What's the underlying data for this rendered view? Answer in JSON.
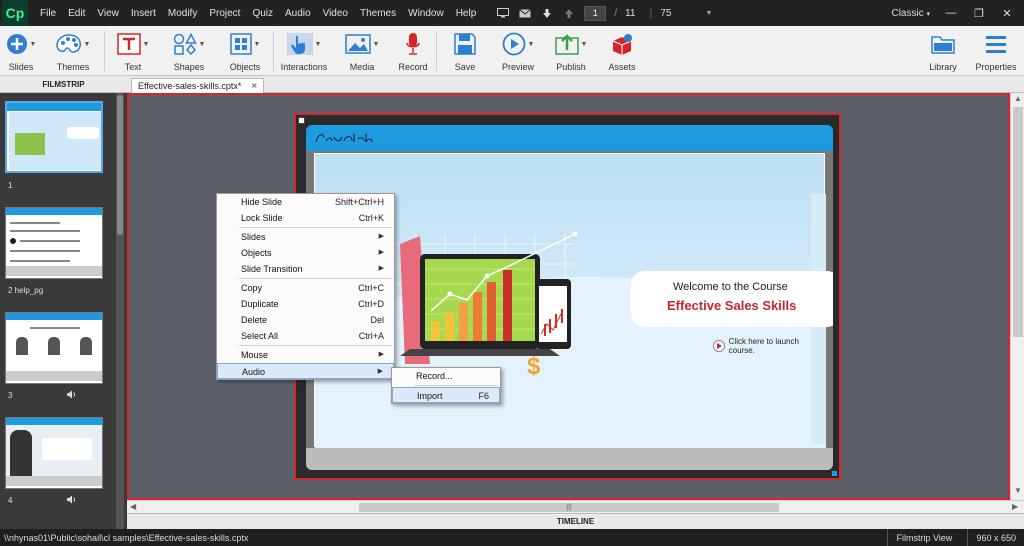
{
  "app": {
    "logo": "Cp",
    "menu": [
      "File",
      "Edit",
      "View",
      "Insert",
      "Modify",
      "Project",
      "Quiz",
      "Audio",
      "Video",
      "Themes",
      "Window",
      "Help"
    ],
    "current_page": "1",
    "page_separator": "/",
    "total_pages": "11",
    "zoom": "75",
    "workspace": "Classic"
  },
  "toolbar": {
    "slides": "Slides",
    "themes": "Themes",
    "text": "Text",
    "shapes": "Shapes",
    "objects": "Objects",
    "interactions": "Interactions",
    "media": "Media",
    "record": "Record",
    "save": "Save",
    "preview": "Preview",
    "publish": "Publish",
    "assets": "Assets",
    "library": "Library",
    "properties": "Properties"
  },
  "filmstrip": {
    "header": "FILMSTRIP",
    "slides": [
      {
        "label": "1"
      },
      {
        "label": "2 help_pg"
      },
      {
        "label": "3"
      },
      {
        "label": "4"
      }
    ]
  },
  "document": {
    "tab": "Effective-sales-skills.cptx*",
    "close": "×"
  },
  "slide": {
    "welcome": "Welcome to the Course",
    "course_title": "Effective Sales Skills",
    "launch": "Click here to launch course."
  },
  "context_menu": {
    "items": [
      {
        "label": "Hide Slide",
        "shortcut": "Shift+Ctrl+H"
      },
      {
        "label": "Lock Slide",
        "shortcut": "Ctrl+K"
      },
      {
        "label": "Slides",
        "shortcut": ""
      },
      {
        "label": "Objects",
        "shortcut": ""
      },
      {
        "label": "Slide Transition",
        "shortcut": ""
      },
      {
        "label": "Copy",
        "shortcut": "Ctrl+C"
      },
      {
        "label": "Duplicate",
        "shortcut": "Ctrl+D"
      },
      {
        "label": "Delete",
        "shortcut": "Del"
      },
      {
        "label": "Select All",
        "shortcut": "Ctrl+A"
      },
      {
        "label": "Mouse",
        "shortcut": ""
      },
      {
        "label": "Audio",
        "shortcut": ""
      }
    ],
    "submenu": [
      {
        "label": "Record...",
        "shortcut": ""
      },
      {
        "label": "Import",
        "shortcut": "F6"
      }
    ]
  },
  "timeline": {
    "label": "TIMELINE"
  },
  "status": {
    "path": "\\\\nhynas01\\Public\\sohail\\cl samples\\Effective-sales-skills.cptx",
    "view": "Filmstrip View",
    "size": "960 x 650"
  },
  "colors": {
    "accent_blue": "#1e9be0",
    "selection_red": "#d5262a",
    "title_red": "#c8262f",
    "menubar": "#222222"
  }
}
